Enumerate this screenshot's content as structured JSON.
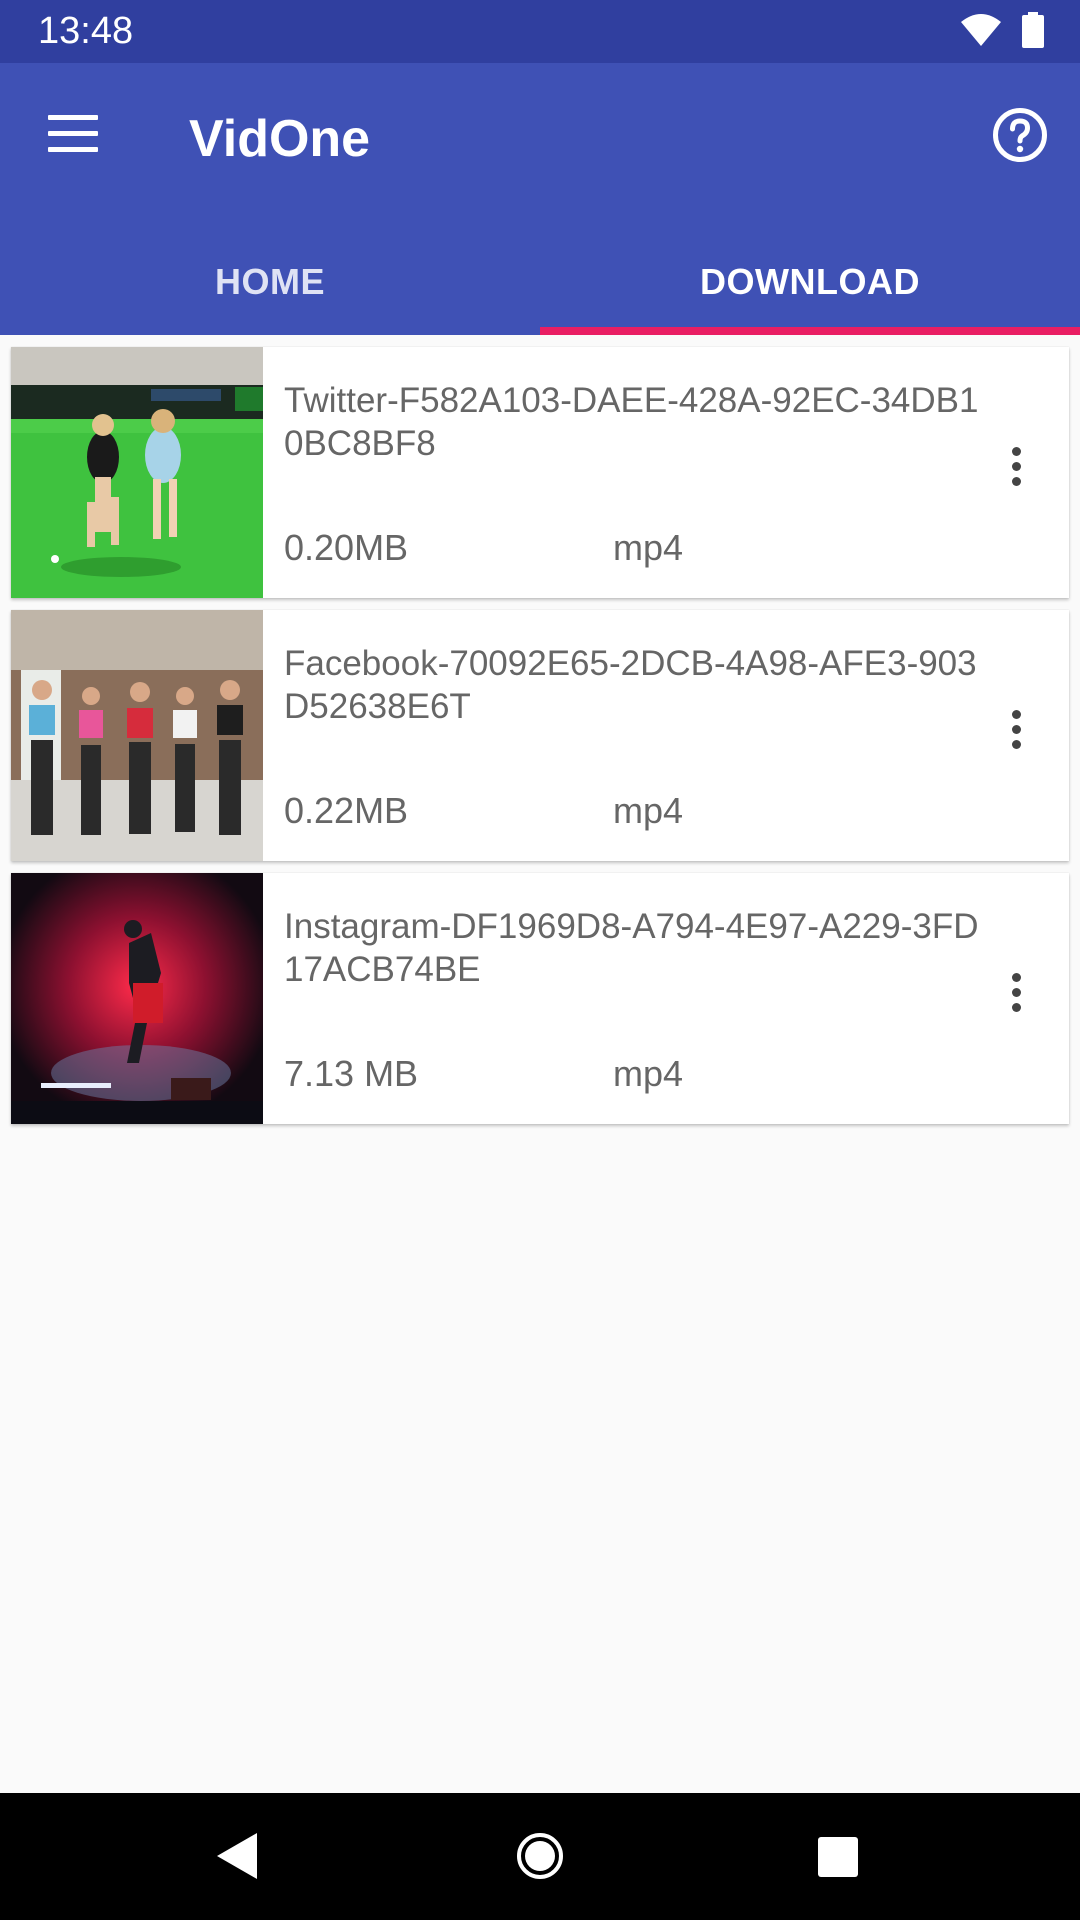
{
  "status_bar": {
    "time": "13:48",
    "icons": [
      "wifi-icon",
      "battery-icon"
    ]
  },
  "app_bar": {
    "title": "VidOne",
    "menu_icon": "menu-icon",
    "help_icon": "help-icon"
  },
  "tabs": [
    {
      "label": "HOME",
      "active": false
    },
    {
      "label": "DOWNLOAD",
      "active": true
    }
  ],
  "downloads": [
    {
      "name": "Twitter-F582A103-DAEE-428A-92EC-34DB10BC8BF8",
      "size": "0.20MB",
      "format": "mp4",
      "thumbnail": "field hockey players on green turf"
    },
    {
      "name": "Facebook-70092E65-2DCB-4A98-AFE3-903D52638E6T",
      "size": "0.22MB",
      "format": "mp4",
      "thumbnail": "group fitness class with dumbbells"
    },
    {
      "name": "Instagram-DF1969D8-A794-4E97-A229-3FD17ACB74BE",
      "size": "7.13 MB",
      "format": "mp4",
      "thumbnail": "breakdancer on stage with red light"
    }
  ],
  "colors": {
    "primary": "#3f51b5",
    "primary_dark": "#303f9f",
    "accent": "#e91e63"
  },
  "nav_bar": {
    "icons": [
      "back-icon",
      "home-icon",
      "recents-icon"
    ]
  }
}
